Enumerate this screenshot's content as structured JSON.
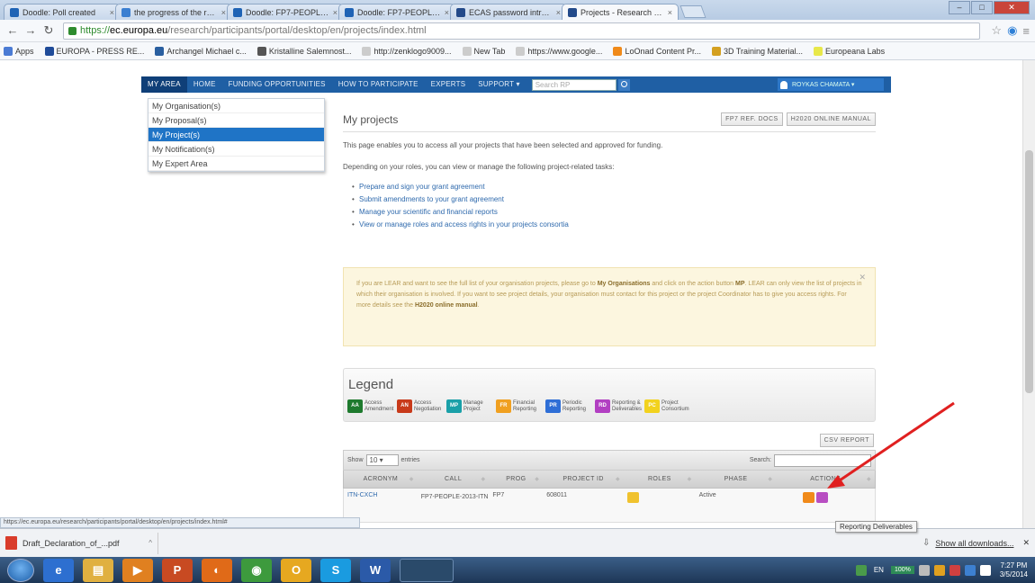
{
  "browser": {
    "tabs": [
      {
        "title": "Doodle: Poll created",
        "color": "#1f63b5",
        "active": false
      },
      {
        "title": "the progress of the recruitm",
        "color": "#3b7fd1",
        "active": false
      },
      {
        "title": "Doodle: FP7-PEOPLE-ITN",
        "color": "#1f63b5",
        "active": false
      },
      {
        "title": "Doodle: FP7-PEOPLE-ITN",
        "color": "#1f63b5",
        "active": false
      },
      {
        "title": "ECAS password introduct",
        "color": "#234a8a",
        "active": false
      },
      {
        "title": "Projects - Research Partic",
        "color": "#234a8a",
        "active": true
      }
    ],
    "url": {
      "scheme": "https://",
      "domain": "ec.europa.eu",
      "path": "/research/participants/portal/desktop/en/projects/index.html"
    },
    "bookmarks": [
      {
        "label": "Apps",
        "color": "#4b7bd4"
      },
      {
        "label": "EUROPA - PRESS RE...",
        "color": "#1f4b99"
      },
      {
        "label": "Archangel Michael c...",
        "color": "#2a5fa0"
      },
      {
        "label": "Kristalline Salemnost...",
        "color": "#555555"
      },
      {
        "label": "http://zenklogo9009...",
        "color": "#cccccc"
      },
      {
        "label": "New Tab",
        "color": "#cccccc"
      },
      {
        "label": "https://www.google...",
        "color": "#cccccc"
      },
      {
        "label": "LoOnad Content Pr...",
        "color": "#f08a1a"
      },
      {
        "label": "3D Training Material...",
        "color": "#d4a020"
      },
      {
        "label": "Europeana Labs",
        "color": "#e8e84a"
      }
    ]
  },
  "topnav": {
    "items": [
      "MY AREA",
      "HOME",
      "FUNDING OPPORTUNITIES",
      "HOW TO PARTICIPATE",
      "EXPERTS",
      "SUPPORT ▾"
    ],
    "search_placeholder": "Search RP",
    "user_label": "ROYKAS CHAMATA ▾"
  },
  "menu": {
    "items": [
      "My Organisation(s)",
      "My Proposal(s)",
      "My Project(s)",
      "My Notification(s)",
      "My Expert Area"
    ],
    "selected_index": 2
  },
  "main": {
    "title": "My projects",
    "buttons": [
      "FP7 REF. DOCS",
      "H2020 ONLINE MANUAL"
    ],
    "intro": "This page enables you to access all your projects that have been selected and approved for funding.",
    "intro2": "Depending on your roles, you can view or manage the following project-related tasks:",
    "tasks": [
      "Prepare and sign your grant agreement",
      "Submit amendments to your grant agreement",
      "Manage your scientific and financial reports",
      "View or manage roles and access rights in your projects consortia"
    ]
  },
  "notice": {
    "text_a": "If you are LEAR and want to see the full list of your organisation projects, please go to ",
    "link_a": "My Organisations",
    "text_b": " and click on the action button ",
    "link_b": "MP",
    "text_c": ". LEAR can only view the list of projects in which their organisation is involved. If you want to see project details, your organisation must contact for this project or the project Coordinator has to give you access rights. For more details see the ",
    "link_c": "H2020 online manual",
    "text_d": "."
  },
  "legend": {
    "title": "Legend",
    "items": [
      {
        "code": "AA",
        "label": "Access Amendment",
        "color": "#1e7a2e"
      },
      {
        "code": "AN",
        "label": "Access Negotiation",
        "color": "#c83a1a"
      },
      {
        "code": "MP",
        "label": "Manage Project",
        "color": "#1aa0a8"
      },
      {
        "code": "FR",
        "label": "Financial Reporting",
        "color": "#f0a020"
      },
      {
        "code": "PR",
        "label": "Periodic Reporting",
        "color": "#2e6ed6"
      },
      {
        "code": "RD",
        "label": "Reporting & Deliverables",
        "color": "#b23fc2"
      },
      {
        "code": "PC",
        "label": "Project Consortium",
        "color": "#f2d21e"
      }
    ]
  },
  "table": {
    "csv_label": "CSV REPORT",
    "show_label": "Show",
    "page_size": "10",
    "entries_label": "entries",
    "search_label": "Search:",
    "headers": [
      "ACRONYM",
      "CALL",
      "PROG",
      "PROJECT ID",
      "ROLES",
      "PHASE",
      "ACTIONS"
    ],
    "rows": [
      {
        "acronym": "ITN-CXCH",
        "call": "FP7-PEOPLE-2013-ITN",
        "prog": "FP7",
        "project_id": "608011",
        "phase": "Active"
      }
    ]
  },
  "tooltip": "Reporting Deliverables",
  "status_url": "https://ec.europa.eu/research/participants/portal/desktop/en/projects/index.html#",
  "download": {
    "file": "Draft_Declaration_of_...pdf",
    "show_all": "Show all downloads..."
  },
  "taskbar": {
    "icons": [
      {
        "name": "ie-icon",
        "glyph": "e",
        "color": "#2d6fd0"
      },
      {
        "name": "explorer-icon",
        "glyph": "▤",
        "color": "#e0b040"
      },
      {
        "name": "media-icon",
        "glyph": "▶",
        "color": "#e08020"
      },
      {
        "name": "powerpoint-icon",
        "glyph": "P",
        "color": "#c84a22"
      },
      {
        "name": "firefox-icon",
        "glyph": "◐",
        "color": "#e06a18"
      },
      {
        "name": "chrome-icon",
        "glyph": "◉",
        "color": "#3d9a3d"
      },
      {
        "name": "outlook-icon",
        "glyph": "O",
        "color": "#e6a820"
      },
      {
        "name": "skype-icon",
        "glyph": "S",
        "color": "#1a9be0"
      },
      {
        "name": "word-icon",
        "glyph": "W",
        "color": "#2b5aa8"
      }
    ],
    "lang": "EN",
    "battery": "100%",
    "time": "7:27 PM",
    "date": "3/5/2014"
  }
}
